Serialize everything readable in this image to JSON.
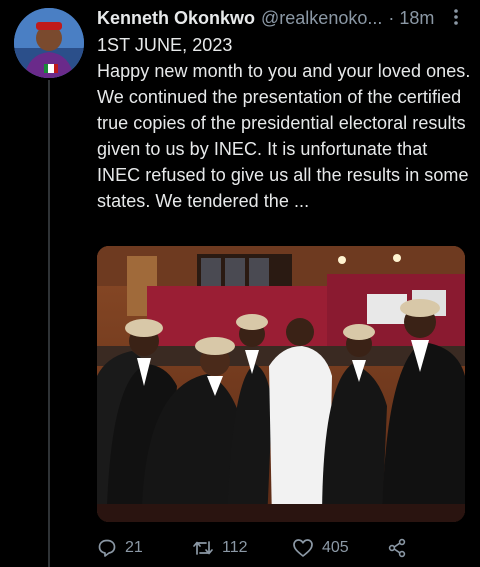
{
  "tweet": {
    "author_name": "Kenneth Okonkwo",
    "handle": "@realkenoko...",
    "separator": "·",
    "time": "18m",
    "more_icon": "more-vertical-icon",
    "text": "1ST JUNE, 2023\nHappy new month to you and your loved ones. We continued the presentation of the certified true copies of the presidential electoral results given to us by INEC. It is unfortunate that INEC refused to give us all the results in some states. We tendered the ..."
  },
  "actions": {
    "replies": "21",
    "retweets": "112",
    "likes": "405",
    "reply_icon": "reply-icon",
    "retweet_icon": "retweet-icon",
    "like_icon": "heart-icon",
    "share_icon": "share-icon"
  },
  "colors": {
    "background": "#000000",
    "text_primary": "#e7e9ea",
    "text_secondary": "#8b98a5"
  }
}
